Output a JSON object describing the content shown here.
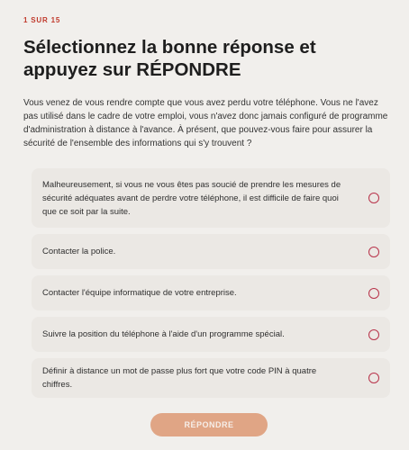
{
  "header": {
    "progress": "1 SUR 15",
    "title": "Sélectionnez la bonne réponse et appuyez sur RÉPONDRE"
  },
  "question": {
    "text": "Vous venez de vous rendre compte que vous avez perdu votre téléphone. Vous ne l'avez pas utilisé dans le cadre de votre emploi, vous n'avez donc jamais configuré de programme d'administration à distance à l'avance. À présent, que pouvez-vous faire pour assurer la sécurité de l'ensemble des informations qui s'y trouvent ?"
  },
  "options": [
    {
      "label": "Malheureusement, si vous ne vous êtes pas soucié de prendre les mesures de sécurité adéquates avant de perdre votre téléphone, il est difficile de faire quoi que ce soit par la suite.",
      "selected": false
    },
    {
      "label": "Contacter la police.",
      "selected": false
    },
    {
      "label": "Contacter l'équipe informatique de votre entreprise.",
      "selected": false
    },
    {
      "label": "Suivre la position du téléphone à l'aide d'un programme spécial.",
      "selected": false
    },
    {
      "label": "Définir à distance un mot de passe plus fort que votre code PIN à quatre chiffres.",
      "selected": false
    }
  ],
  "actions": {
    "submit_label": "RÉPONDRE"
  },
  "colors": {
    "accent": "#c0392b",
    "radio_border": "#b8334a",
    "button_disabled": "#e0a585",
    "background": "#f1efec",
    "option_background": "#ebe8e4"
  }
}
